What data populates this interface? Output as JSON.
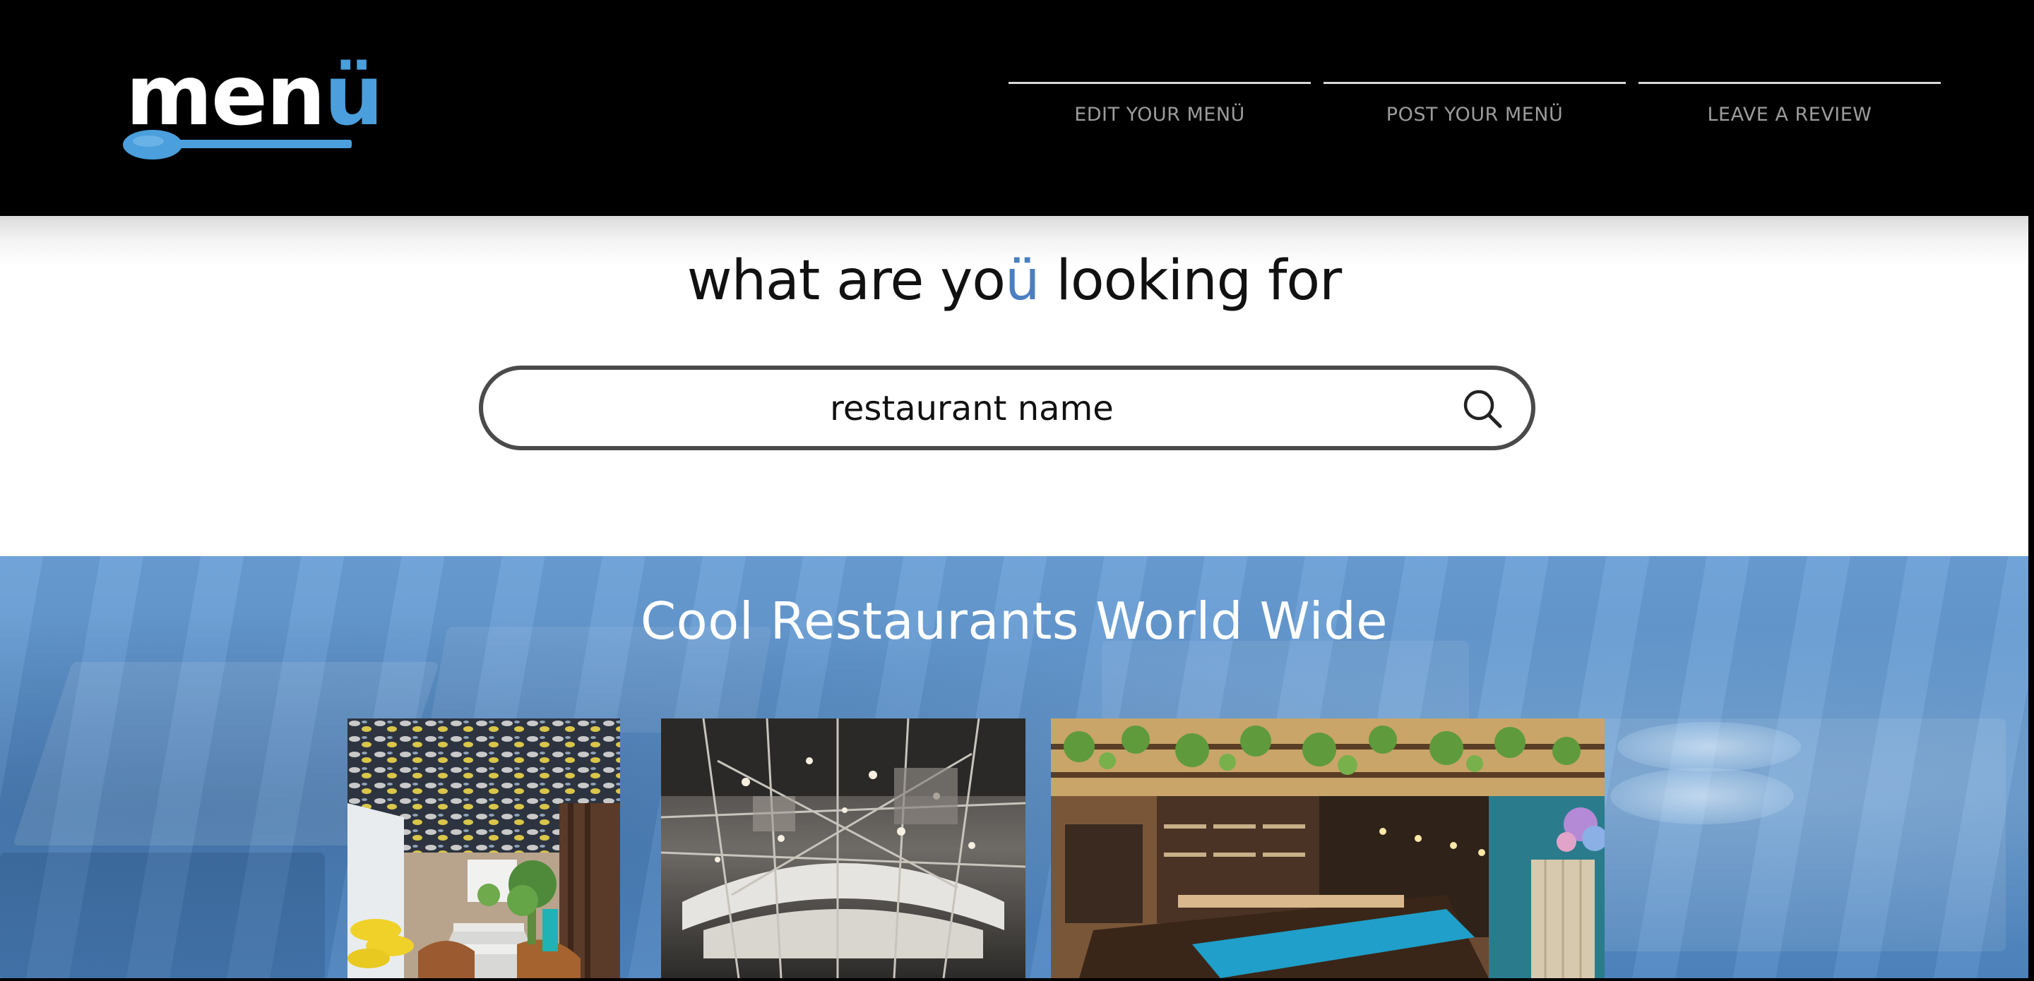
{
  "header": {
    "logo": {
      "text_main": "men",
      "text_accent": "ü"
    },
    "nav": [
      {
        "label": "EDIT YOUR MENÜ"
      },
      {
        "label": "POST YOUR MENÜ"
      },
      {
        "label": "LEAVE A REVIEW"
      }
    ]
  },
  "search": {
    "heading_before": "what are yo",
    "heading_accent": "ü",
    "heading_after": " looking for",
    "placeholder": "restaurant name",
    "value": ""
  },
  "feature": {
    "title": "Cool Restaurants World Wide",
    "gallery": [
      {
        "name": "restaurant-photo-1"
      },
      {
        "name": "restaurant-photo-2"
      },
      {
        "name": "restaurant-photo-3"
      }
    ]
  },
  "colors": {
    "accent_blue": "#4a9fdc",
    "heading_accent": "#4a7fc1",
    "header_bg": "#000000",
    "nav_text": "#9c9c9c",
    "feature_bg": "#5f94cc"
  },
  "icons": {
    "search": "search-icon",
    "logo_spoon": "spoon-icon"
  }
}
